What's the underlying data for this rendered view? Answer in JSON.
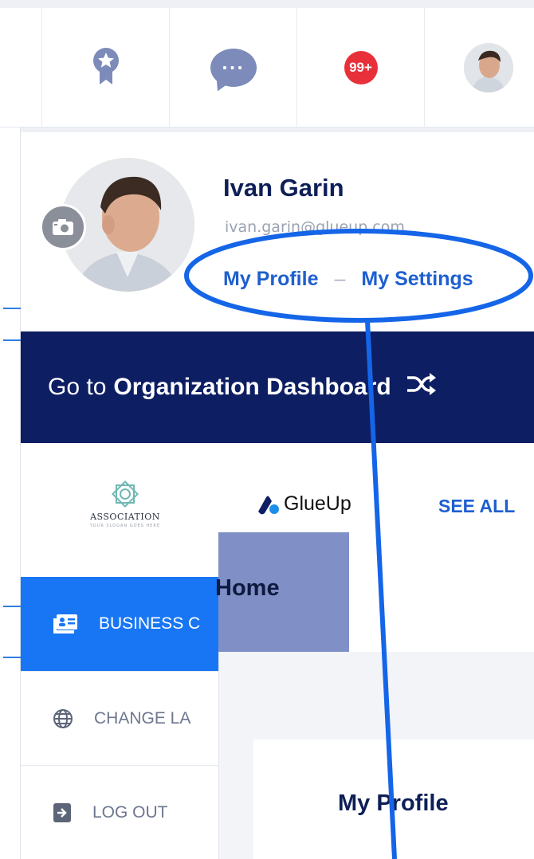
{
  "header": {
    "notification_count": "99+"
  },
  "profile": {
    "name": "Ivan Garin",
    "email": "ivan.garin@glueup.com",
    "my_profile_label": "My Profile",
    "separator": "–",
    "my_settings_label": "My Settings"
  },
  "org_dashboard": {
    "prefix": "Go to",
    "label": "Organization Dashboard"
  },
  "organizations": {
    "association_name": "ASSOCIATION",
    "association_tagline": "YOUR SLOGAN GOES HERE",
    "glueup_name": "GlueUp",
    "see_all_label": "SEE ALL"
  },
  "menu": {
    "items": [
      {
        "label": "BUSINESS C",
        "icon": "business-card-icon"
      },
      {
        "label": "CHANGE LA",
        "icon": "globe-icon"
      },
      {
        "label": "LOG OUT",
        "icon": "logout-icon"
      }
    ]
  },
  "page": {
    "home_tab": "Home",
    "card_title": "My Profile"
  },
  "colors": {
    "navy": "#0d1e63",
    "link_blue": "#1d5fd0",
    "active_blue": "#1876f4",
    "badge_red": "#e8303a",
    "annotation_blue": "#1565e8"
  }
}
